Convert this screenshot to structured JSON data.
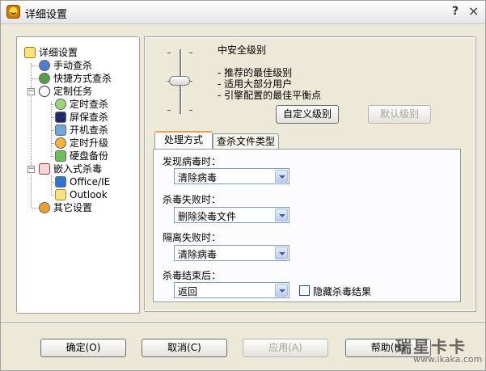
{
  "window": {
    "title": "详细设置"
  },
  "titlebar": {
    "help": "?",
    "close": "×"
  },
  "tree": {
    "items": [
      {
        "label": "详细设置"
      },
      {
        "label": "手动查杀"
      },
      {
        "label": "快捷方式查杀"
      },
      {
        "label": "定制任务"
      },
      {
        "label": "定时查杀"
      },
      {
        "label": "屏保查杀"
      },
      {
        "label": "开机查杀"
      },
      {
        "label": "定时升级"
      },
      {
        "label": "硬盘备份"
      },
      {
        "label": "嵌入式杀毒"
      },
      {
        "label": "Office/IE"
      },
      {
        "label": "Outlook"
      },
      {
        "label": "其它设置"
      }
    ]
  },
  "security": {
    "level_title": "中安全级别",
    "desc": [
      "- 推荐的最佳级别",
      "- 适用大部分用户",
      "- 引擎配置的最佳平衡点"
    ],
    "custom_button": "自定义级别",
    "default_button": "默认级别"
  },
  "tabs": [
    {
      "label": "处理方式"
    },
    {
      "label": "查杀文件类型"
    }
  ],
  "fields": [
    {
      "label": "发现病毒时：",
      "value": "清除病毒"
    },
    {
      "label": "杀毒失败时：",
      "value": "删除染毒文件"
    },
    {
      "label": "隔离失败时：",
      "value": "清除病毒"
    },
    {
      "label": "杀毒结束后：",
      "value": "返回"
    }
  ],
  "hide_results": {
    "label": "隐藏杀毒结果",
    "checked": false
  },
  "footer": {
    "ok": "确定(O)",
    "cancel": "取消(C)",
    "apply": "应用(A)",
    "help": "帮助(H)"
  },
  "watermark": {
    "title": "瑞星卡卡",
    "url": "www.ikaka.com"
  }
}
